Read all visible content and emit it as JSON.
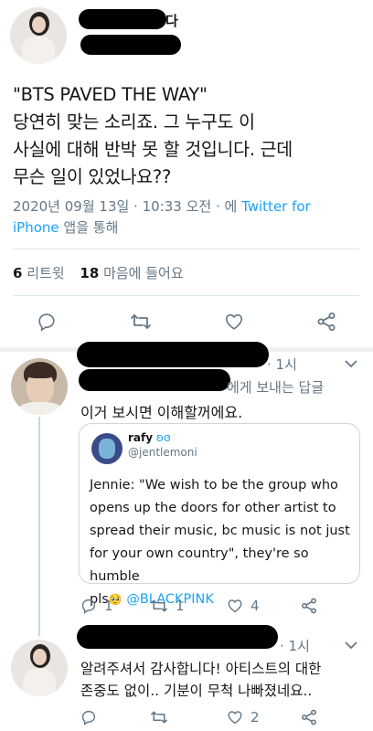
{
  "main_tweet": {
    "author_name_visible": "다",
    "text_lines": [
      "\"BTS PAVED THE WAY\"",
      "당연히 맞는 소리죠. 그 누구도 이",
      "사실에 대해 반박 못 할 것입니다. 근데",
      "무슨 일이 있었나요??"
    ],
    "meta_date": "2020년 09월 13일 · 10:33 오전 · 에 ",
    "meta_source_1": "Twitter for",
    "meta_source_2": "iPhone",
    "meta_suffix": " 앱을 통해",
    "stats": {
      "retweets_count": "6",
      "retweets_label": "리트윗",
      "likes_count": "18",
      "likes_label": "마음에 들어요"
    }
  },
  "reply_1": {
    "time": "· 1시",
    "reply_to_suffix": "에게 보내는 답글",
    "text": "이거 보시면 이해할꺼에요.",
    "quoted": {
      "name": "rafy",
      "handle": "@jentlemoni",
      "text_lines": [
        "Jennie: \"We wish to be the group who",
        "opens up the doors for other artist to",
        "spread their music, bc music is not just",
        "for your own country\", they're so humble",
        "pls"
      ],
      "mention": "@BLACKPINK",
      "emoji": "🥺"
    },
    "reply_count": "1",
    "retweet_count": "1",
    "like_count": "4"
  },
  "reply_2": {
    "time": "· 1시",
    "text_lines": [
      "알려주셔서 감사합니다! 아티스트의 대한",
      "존중도 없이.. 기분이 무척 나빠졌네요.."
    ],
    "like_count": "2"
  },
  "colors": {
    "link": "#1da1f2",
    "muted": "#657786",
    "divider": "#e1e8ed"
  }
}
